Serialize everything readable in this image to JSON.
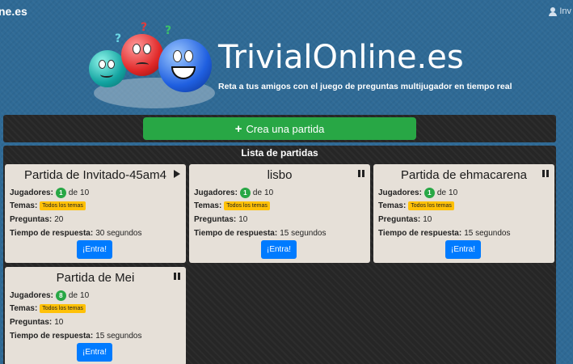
{
  "header": {
    "site_short": "ne.es",
    "user_label": "Inv"
  },
  "brand": {
    "title": "TrivialOnline.es",
    "tagline": "Reta a tus amigos con el juego de preguntas multijugador en tiempo real"
  },
  "create": {
    "label": "Crea una partida",
    "icon": "plus-icon"
  },
  "list": {
    "title": "Lista de partidas",
    "labels": {
      "players": "Jugadores:",
      "of": "de",
      "topics": "Temas:",
      "questions": "Preguntas:",
      "time": "Tiempo de respuesta:",
      "enter": "¡Entra!"
    },
    "games": [
      {
        "title": "Partida de Invitado-45am4",
        "status": "playing",
        "status_icon": "play-icon",
        "players": "1",
        "max_players": "10",
        "topics": "Todos los temas",
        "questions": "20",
        "time": "30 segundos"
      },
      {
        "title": "lisbo",
        "status": "paused",
        "status_icon": "pause-icon",
        "players": "1",
        "max_players": "10",
        "topics": "Todos los temas",
        "questions": "10",
        "time": "15 segundos"
      },
      {
        "title": "Partida de ehmacarena",
        "status": "paused",
        "status_icon": "pause-icon",
        "players": "1",
        "max_players": "10",
        "topics": "Todos los temas",
        "questions": "10",
        "time": "15 segundos"
      },
      {
        "title": "Partida de Mei",
        "status": "paused",
        "status_icon": "pause-icon",
        "players": "8",
        "max_players": "10",
        "topics": "Todos los temas",
        "questions": "10",
        "time": "15 segundos"
      }
    ]
  },
  "colors": {
    "background": "#2f6a96",
    "panel": "#262626",
    "card": "#e6e0d8",
    "create_button": "#28a745",
    "enter_button": "#007bff",
    "player_badge": "#28a745",
    "topic_badge": "#ffc107"
  }
}
